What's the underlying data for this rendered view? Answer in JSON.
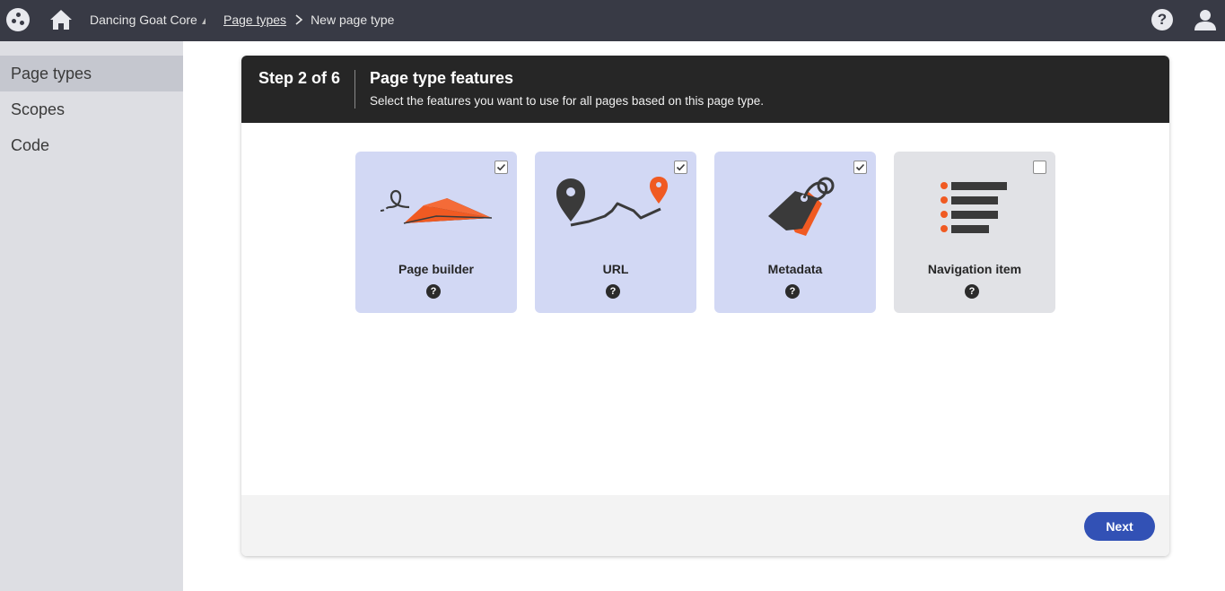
{
  "topbar": {
    "site_name": "Dancing Goat Core",
    "breadcrumb": {
      "link": "Page types",
      "current": "New page type"
    },
    "help_label": "?"
  },
  "sidebar": {
    "items": [
      {
        "label": "Page types",
        "active": true
      },
      {
        "label": "Scopes",
        "active": false
      },
      {
        "label": "Code",
        "active": false
      }
    ]
  },
  "wizard": {
    "step": "Step 2 of 6",
    "title": "Page type features",
    "subtitle": "Select the features you want to use for all pages based on this page type.",
    "features": [
      {
        "label": "Page builder",
        "checked": true,
        "icon": "paper-plane-icon",
        "help": "?"
      },
      {
        "label": "URL",
        "checked": true,
        "icon": "route-pin-icon",
        "help": "?"
      },
      {
        "label": "Metadata",
        "checked": true,
        "icon": "tags-icon",
        "help": "?"
      },
      {
        "label": "Navigation item",
        "checked": false,
        "icon": "list-icon",
        "help": "?"
      }
    ],
    "next_label": "Next"
  },
  "colors": {
    "topbar": "#383a45",
    "sidebar": "#dddee3",
    "tile_selected": "#d2d8f4",
    "tile_unselected": "#e1e2e6",
    "accent_orange": "#f05a22",
    "primary_button": "#3251b5"
  }
}
